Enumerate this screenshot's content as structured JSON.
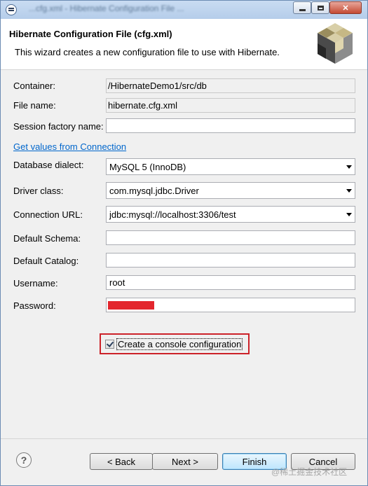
{
  "window": {
    "title_blurred": "...cfg.xml - Hibernate Configuration File ..."
  },
  "header": {
    "title": "Hibernate Configuration File (cfg.xml)",
    "description": "This wizard creates a new configuration file to use with Hibernate."
  },
  "form": {
    "container": {
      "label": "Container:",
      "value": "/HibernateDemo1/src/db"
    },
    "file_name": {
      "label": "File name:",
      "value": "hibernate.cfg.xml"
    },
    "session_factory": {
      "label": "Session factory name:",
      "value": ""
    },
    "get_values_link": "Get values from Connection",
    "dialect": {
      "label": "Database dialect:",
      "value": "MySQL 5 (InnoDB)"
    },
    "driver": {
      "label": "Driver class:",
      "value": "com.mysql.jdbc.Driver"
    },
    "url": {
      "label": "Connection URL:",
      "value": "jdbc:mysql://localhost:3306/test"
    },
    "schema": {
      "label": "Default Schema:",
      "value": ""
    },
    "catalog": {
      "label": "Default Catalog:",
      "value": ""
    },
    "username": {
      "label": "Username:",
      "value": "root"
    },
    "password": {
      "label": "Password:",
      "value": ""
    },
    "console_config": {
      "label": "Create a console configuration",
      "checked": true
    }
  },
  "buttons": {
    "back": "< Back",
    "next": "Next >",
    "finish": "Finish",
    "cancel": "Cancel",
    "help": "?"
  },
  "watermark": "@稀土掘金技术社区",
  "colors": {
    "link": "#0066cc",
    "highlight": "#cc2229",
    "redaction": "#e3262d"
  }
}
